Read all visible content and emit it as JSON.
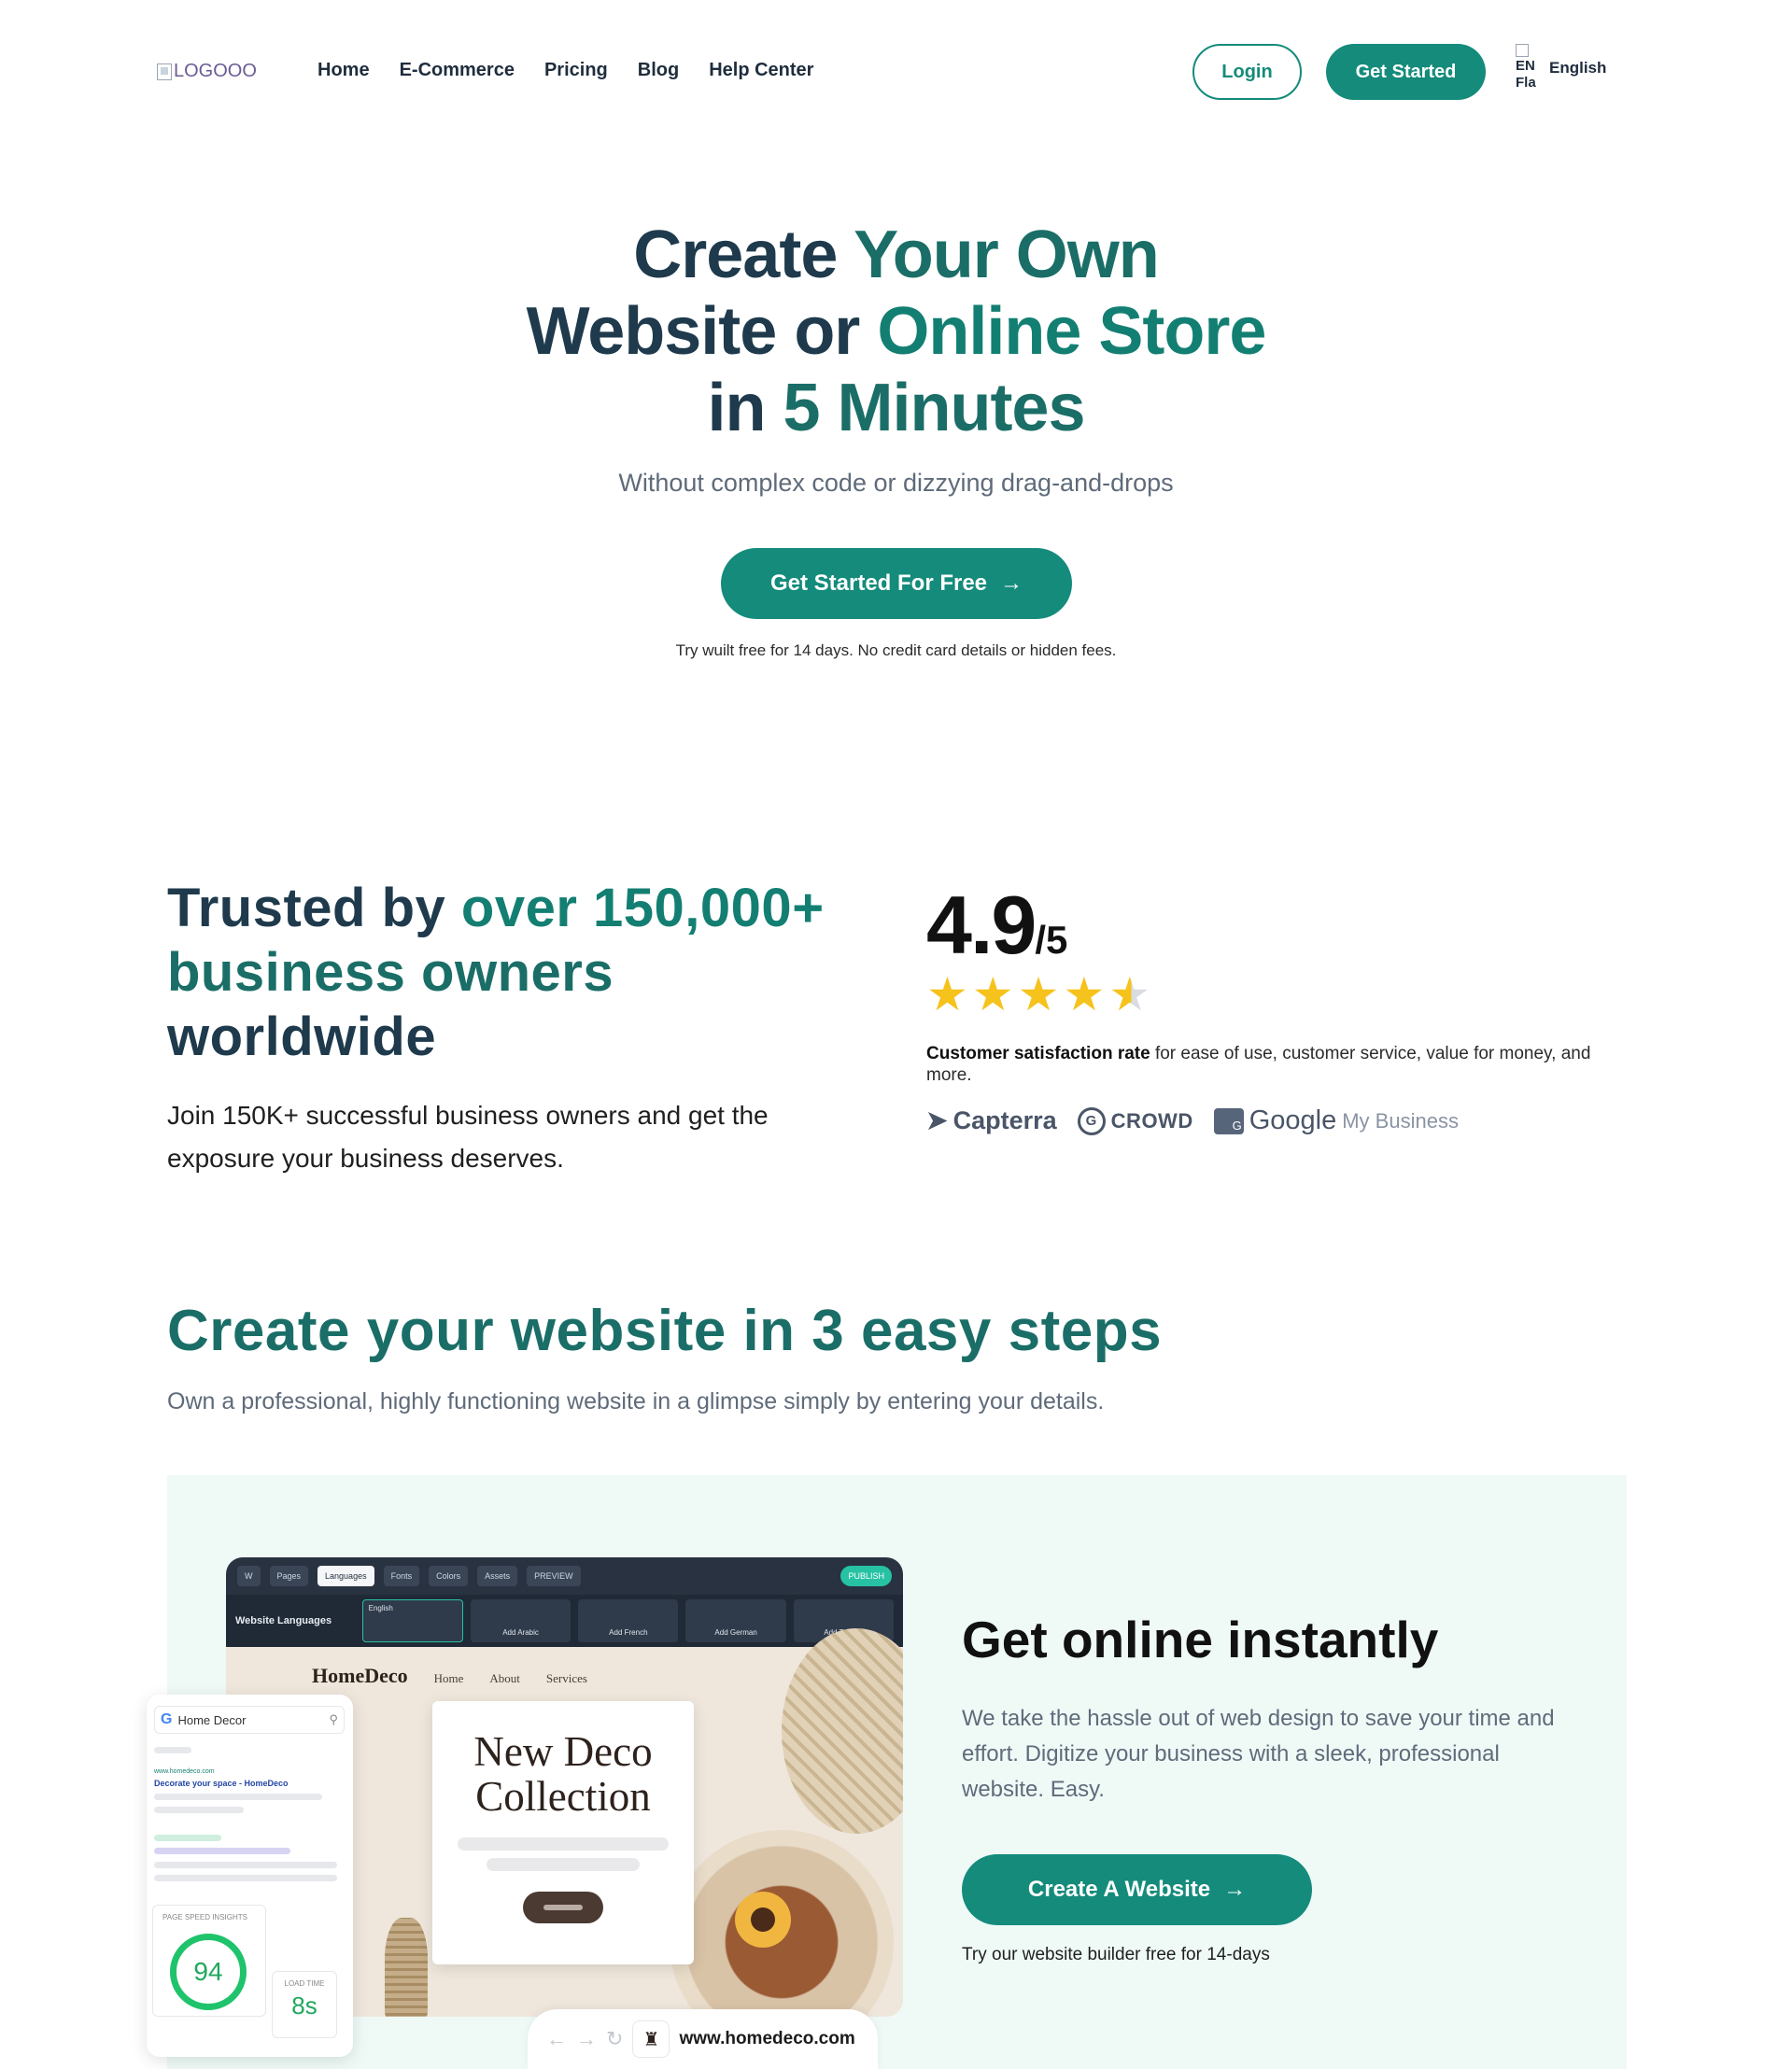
{
  "nav": {
    "logo_alt": "LOGOOO",
    "links": [
      "Home",
      "E-Commerce",
      "Pricing",
      "Blog",
      "Help Center"
    ],
    "login": "Login",
    "get_started": "Get Started",
    "flag_alt_1": "EN",
    "flag_alt_2": "Fla",
    "language": "English"
  },
  "hero": {
    "title_1a": "Create ",
    "title_1b": "Your Own",
    "title_2a": "Website or ",
    "title_2b": "Online Store",
    "title_3a": "in ",
    "title_3b": "5 Minutes",
    "subtitle": "Without complex code or dizzying drag-and-drops",
    "cta": "Get Started For Free",
    "note": "Try wuilt free for 14 days. No credit card details or hidden fees."
  },
  "trust": {
    "title_a": "Trusted by ",
    "title_b": "over 150,000+",
    "title_c": "business owners",
    "title_d": "worldwide",
    "description": "Join 150K+ successful business owners and get the exposure your business deserves.",
    "rating": "4.9",
    "rating_of": "/5",
    "stars": 4.5,
    "satisfaction_bold": "Customer satisfaction rate",
    "satisfaction_rest": " for ease of use, customer service, value for money, and more.",
    "brands": {
      "capterra": "Capterra",
      "g2": "CROWD",
      "google": "Google",
      "google_mb": "My Business"
    }
  },
  "steps": {
    "title": "Create your website in 3 easy steps",
    "subtitle": "Own a professional, highly functioning website in a glimpse simply by entering your details.",
    "mockup": {
      "toolbar": [
        "Pages",
        "Languages",
        "Fonts",
        "Colors",
        "Assets"
      ],
      "preview": "PREVIEW",
      "publish": "PUBLISH",
      "website_languages": "Website Languages",
      "english": "English",
      "add_langs": [
        "Add Arabic",
        "Add French",
        "Add German",
        "Add Turkish"
      ],
      "site_brand": "HomeDeco",
      "site_links": [
        "Home",
        "About",
        "Services"
      ],
      "card_title_1": "New Deco",
      "card_title_2": "Collection",
      "search_query": "Home Decor",
      "result_url": "www.homedeco.com",
      "result_title": "Decorate your space - HomeDeco",
      "psi_label": "PAGE SPEED INSIGHTS",
      "psi_score": "94",
      "load_label": "LOAD TIME",
      "load_value": "8s",
      "url": "www.homedeco.com"
    },
    "card": {
      "title": "Get online instantly",
      "description": "We take the hassle out of web design to save your time and effort. Digitize your business with a sleek, professional website. Easy.",
      "cta": "Create A Website",
      "note": "Try our website builder free for 14-days"
    }
  },
  "colors": {
    "brand_teal": "#148b7b",
    "heading_navy": "#1e3a4c",
    "star_gold": "#f6c21c",
    "panel_bg": "#effaf7"
  }
}
